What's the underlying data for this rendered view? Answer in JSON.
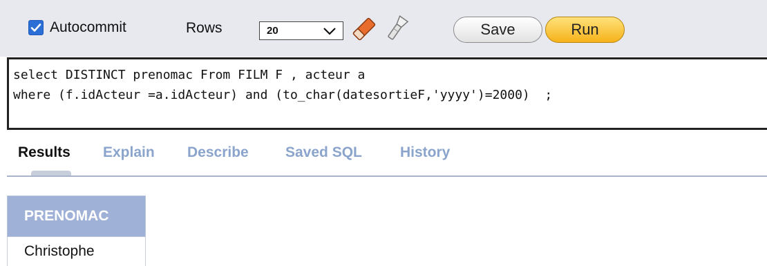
{
  "toolbar": {
    "autocommit_label": "Autocommit",
    "autocommit_checked": true,
    "rows_label": "Rows",
    "rows_value": "20",
    "save_label": "Save",
    "run_label": "Run",
    "icons": [
      "eraser-icon",
      "flashlight-icon"
    ]
  },
  "editor": {
    "sql": "select DISTINCT prenomac From FILM F , acteur a\nwhere (f.idActeur =a.idActeur) and (to_char(datesortieF,'yyyy')=2000)  ;"
  },
  "tabs": [
    {
      "label": "Results",
      "active": true
    },
    {
      "label": "Explain",
      "active": false
    },
    {
      "label": "Describe",
      "active": false
    },
    {
      "label": "Saved SQL",
      "active": false
    },
    {
      "label": "History",
      "active": false
    }
  ],
  "results": {
    "columns": [
      "PRENOMAC"
    ],
    "rows": [
      [
        "Christophe"
      ]
    ]
  },
  "colors": {
    "run_button": "#f6b21a",
    "tab_inactive": "#8aa4cc",
    "table_header": "#9fb1d6"
  }
}
